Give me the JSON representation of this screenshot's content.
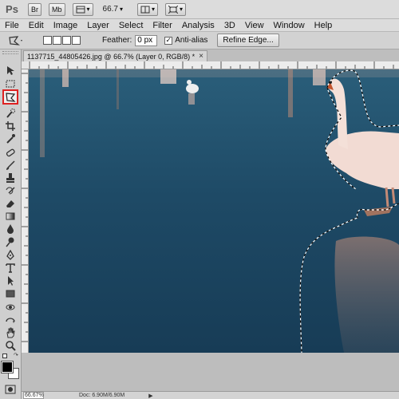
{
  "app": {
    "logo": "Ps",
    "bridge_label": "Br",
    "minibridge_label": "Mb",
    "zoom_value": "66.7",
    "caret": "▾"
  },
  "menu": {
    "items": [
      "File",
      "Edit",
      "Image",
      "Layer",
      "Select",
      "Filter",
      "Analysis",
      "3D",
      "View",
      "Window",
      "Help"
    ]
  },
  "options": {
    "feather_label": "Feather:",
    "feather_value": "0 px",
    "antialias_label": "Anti-alias",
    "antialias_checked": "✓",
    "refine_edge_label": "Refine Edge..."
  },
  "document": {
    "tab_title": "1137715_44805426.jpg @ 66.7% (Layer 0, RGB/8) *",
    "close_glyph": "×"
  },
  "status": {
    "zoom": "66.67%",
    "doc_info": "Doc: 6.90M/6.90M",
    "arrow": "▶"
  },
  "tools": {
    "active": "polygonal-lasso-tool",
    "foreground_color": "#000000",
    "background_color": "#ffffff"
  },
  "colors": {
    "water": "#1f4d68",
    "swan": "#f3dcd3",
    "active_tool_highlight": "#dd2222"
  }
}
